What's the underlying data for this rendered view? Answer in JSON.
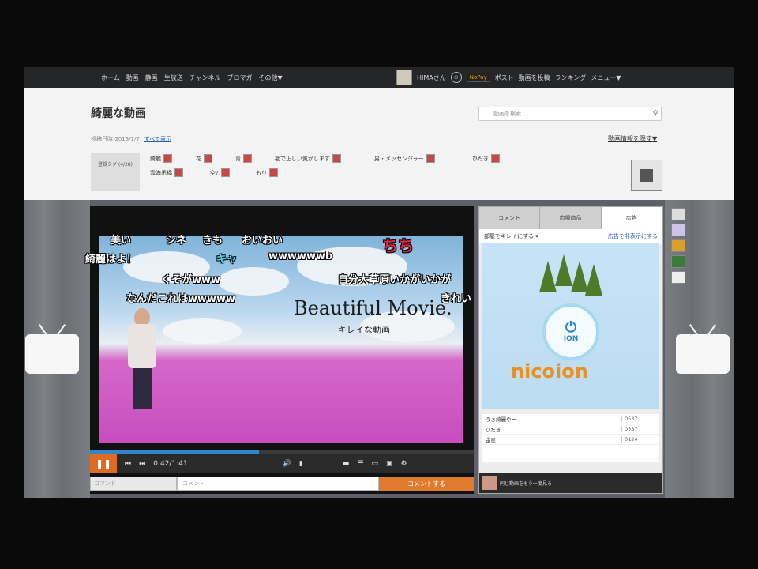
{
  "topnav": {
    "links": [
      "ホーム",
      "動画",
      "静画",
      "生放送",
      "チャンネル",
      "ブロマガ",
      "その他▼"
    ],
    "user": "HIMAさん",
    "premium": "NoPay",
    "right_links": [
      "ポスト",
      "動画を投稿",
      "ランキング",
      "メニュー▼"
    ]
  },
  "header": {
    "title": "綺麗な動画",
    "search_placeholder": "動画を検索",
    "meta_text": "投稿日時:2013/1/7",
    "meta_link": "すべて表示",
    "right_link": "動画情報を隠す▼",
    "tagbox": "登録タグ\n(4/28)",
    "tags": [
      "綺麗",
      "花",
      "青",
      "勘で正しい気がします",
      "男・メッセンジャー",
      "ひだぎ",
      "雲海吊橋",
      "空?",
      "もり"
    ]
  },
  "video": {
    "title": "Beautiful Movie.",
    "subtitle": "キレイな動画",
    "time": "0:42/1:41",
    "progress": 0.44,
    "comments": [
      {
        "text": "美い",
        "cls": ""
      },
      {
        "text": "シネ",
        "cls": ""
      },
      {
        "text": "きも",
        "cls": ""
      },
      {
        "text": "おいおい",
        "cls": ""
      },
      {
        "text": "ちち",
        "cls": "red"
      },
      {
        "text": "綺麗はよ！",
        "cls": ""
      },
      {
        "text": "キャ",
        "cls": "cyan"
      },
      {
        "text": "wwwwwwb",
        "cls": ""
      },
      {
        "text": "くそがwww",
        "cls": ""
      },
      {
        "text": "自分大草原いかがいかが",
        "cls": ""
      },
      {
        "text": "なんだこれはwwwww",
        "cls": ""
      },
      {
        "text": "きれい",
        "cls": ""
      }
    ]
  },
  "comment_input": {
    "command": "コマンド",
    "body": "コメント",
    "send": "コメントする"
  },
  "panel": {
    "tabs": [
      "コメント",
      "市場商品",
      "広告"
    ],
    "bar_left": "部屋をキレイにする ▾",
    "bar_right": "広告を非表示にする",
    "ion_label": "ION",
    "brand": "nicoion",
    "rows": [
      {
        "c": "うぁ綺麗やー",
        "v": "0537"
      },
      {
        "c": "ひだぎ",
        "v": "0537"
      },
      {
        "c": "金星",
        "v": "0124"
      }
    ],
    "footer": "同じ動画をもう一度見る"
  }
}
